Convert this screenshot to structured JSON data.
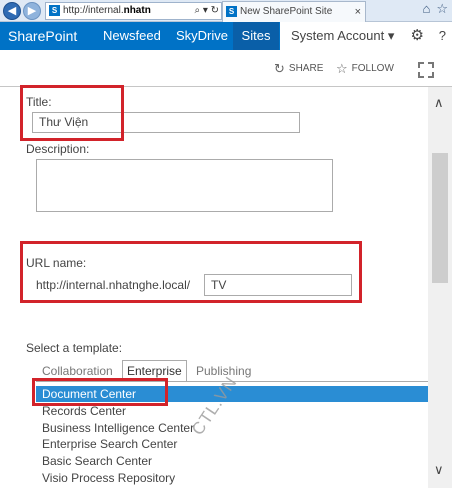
{
  "browser": {
    "back_icon": "back-arrow-icon",
    "forward_icon": "forward-arrow-icon",
    "address_prefix": "http://internal.",
    "address_bold": "nhatn",
    "address_controls": "⌕ ▾ ↻",
    "tab_title": "New SharePoint Site",
    "tab_close": "×",
    "home_icon": "⌂",
    "star_icon": "☆"
  },
  "suite_bar": {
    "brand": "SharePoint",
    "links": [
      "Newsfeed",
      "SkyDrive",
      "Sites"
    ],
    "active_link": "Sites",
    "account": "System Account ▾",
    "gear_icon": "⚙",
    "help_icon": "?"
  },
  "actions": {
    "share_label": "SHARE",
    "follow_label": "FOLLOW",
    "share_icon": "↻",
    "follow_icon": "☆"
  },
  "form": {
    "title_label": "Title:",
    "title_value": "Thư Viện",
    "description_label": "Description:",
    "description_value": "",
    "url_label": "URL name:",
    "url_prefix": "http://internal.nhatnghe.local/",
    "url_value": "TV",
    "template_label": "Select a template:",
    "template_tabs": [
      "Collaboration",
      "Enterprise",
      "Publishing"
    ],
    "selected_tab": "Enterprise",
    "templates": [
      "Document Center",
      "Records Center",
      "Business Intelligence Center",
      "Enterprise Search Center",
      "Basic Search Center",
      "Visio Process Repository"
    ],
    "selected_template": "Document Center"
  },
  "scroll": {
    "up_icon": "∧",
    "down_icon": "∨"
  },
  "watermark": "CTL.VN",
  "colors": {
    "suite_bar": "#0072c6",
    "highlight": "#d2232a",
    "selection": "#2a8dd4"
  }
}
